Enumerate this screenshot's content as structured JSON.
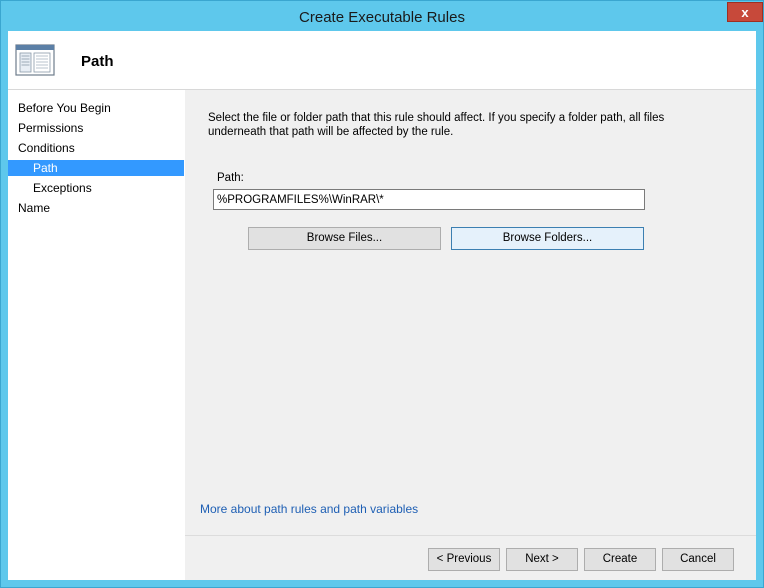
{
  "window": {
    "title": "Create Executable Rules",
    "close_label": "x"
  },
  "header": {
    "title": "Path",
    "icon": "wizard-page-icon"
  },
  "nav": {
    "items": [
      {
        "label": "Before You Begin"
      },
      {
        "label": "Permissions"
      },
      {
        "label": "Conditions"
      },
      {
        "label": "Path",
        "selected": true
      },
      {
        "label": "Exceptions"
      },
      {
        "label": "Name"
      }
    ]
  },
  "main": {
    "description": "Select the file or folder path that this rule should affect. If you specify a folder path, all files underneath that path will be affected by the rule.",
    "path_label": "Path:",
    "path_value": "%PROGRAMFILES%\\WinRAR\\*",
    "browse_files_label": "Browse Files...",
    "browse_folders_label": "Browse Folders...",
    "more_link": "More about path rules and path variables"
  },
  "footer": {
    "previous_label": "< Previous",
    "next_label": "Next >",
    "create_label": "Create",
    "cancel_label": "Cancel"
  },
  "colors": {
    "titlebar": "#5ec8ec",
    "selection": "#3399ff",
    "link": "#1e5fb4",
    "close": "#c7493a"
  }
}
